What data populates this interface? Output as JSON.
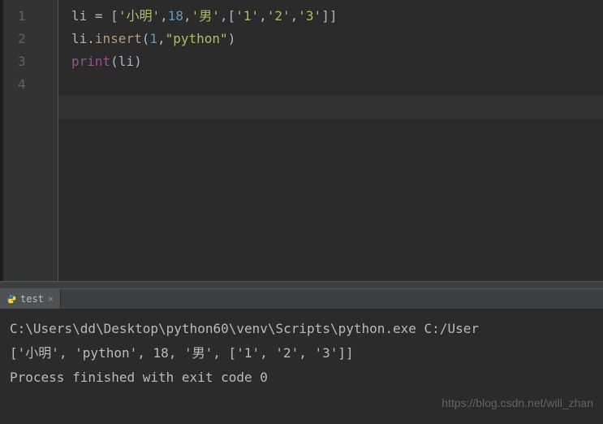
{
  "editor": {
    "lines": [
      {
        "num": "1",
        "tokens": [
          {
            "t": "li ",
            "c": "tok-default"
          },
          {
            "t": "= [",
            "c": "tok-operator"
          },
          {
            "t": "'小明'",
            "c": "tok-string"
          },
          {
            "t": ",",
            "c": "tok-operator"
          },
          {
            "t": "18",
            "c": "tok-number"
          },
          {
            "t": ",",
            "c": "tok-operator"
          },
          {
            "t": "'男'",
            "c": "tok-string"
          },
          {
            "t": ",[",
            "c": "tok-operator"
          },
          {
            "t": "'1'",
            "c": "tok-string"
          },
          {
            "t": ",",
            "c": "tok-operator"
          },
          {
            "t": "'2'",
            "c": "tok-string"
          },
          {
            "t": ",",
            "c": "tok-operator"
          },
          {
            "t": "'3'",
            "c": "tok-string"
          },
          {
            "t": "]]",
            "c": "tok-operator"
          }
        ]
      },
      {
        "num": "2",
        "tokens": [
          {
            "t": "li.",
            "c": "tok-default"
          },
          {
            "t": "insert",
            "c": "tok-method"
          },
          {
            "t": "(",
            "c": "tok-operator"
          },
          {
            "t": "1",
            "c": "tok-number"
          },
          {
            "t": ",",
            "c": "tok-operator"
          },
          {
            "t": "\"python\"",
            "c": "tok-string"
          },
          {
            "t": ")",
            "c": "tok-operator"
          }
        ]
      },
      {
        "num": "3",
        "tokens": [
          {
            "t": "print",
            "c": "tok-print"
          },
          {
            "t": "(li)",
            "c": "tok-default"
          }
        ]
      },
      {
        "num": "4",
        "tokens": []
      }
    ],
    "current_line_index": 3
  },
  "terminal": {
    "tab_label": "test",
    "output": [
      "C:\\Users\\dd\\Desktop\\python60\\venv\\Scripts\\python.exe C:/User",
      "['小明', 'python', 18, '男', ['1', '2', '3']]",
      "",
      "Process finished with exit code 0"
    ]
  },
  "watermark": "https://blog.csdn.net/will_zhan"
}
